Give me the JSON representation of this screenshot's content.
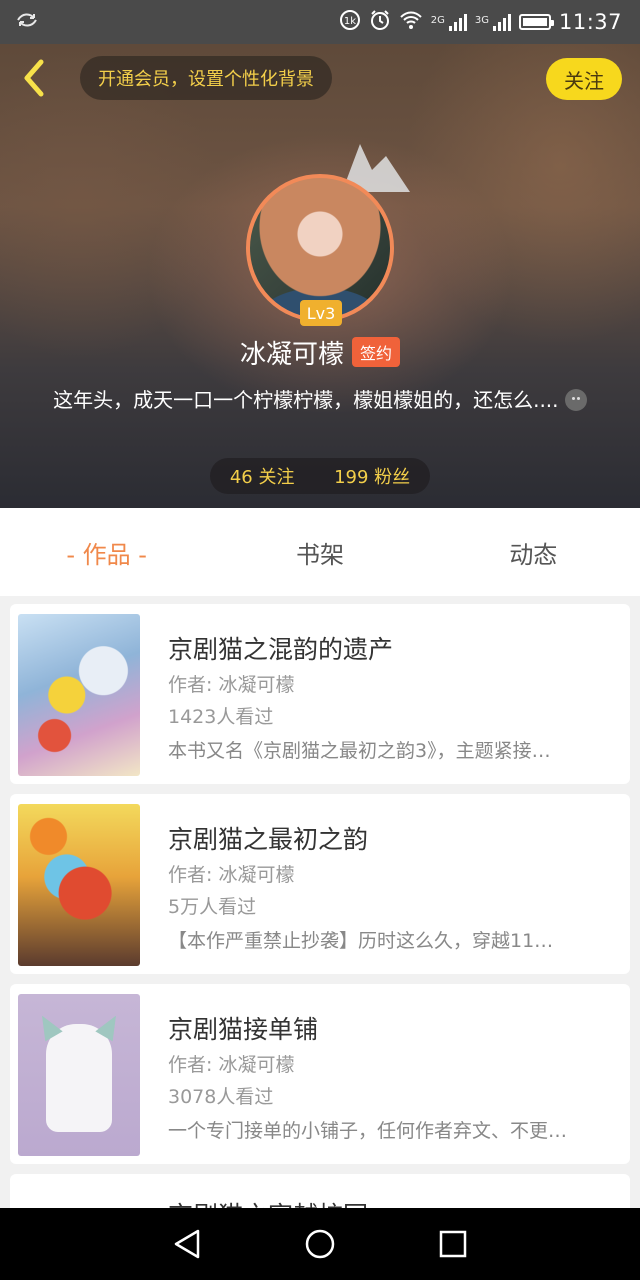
{
  "status_bar": {
    "network_tag_1": "2G",
    "network_tag_2": "3G",
    "time": "11:37",
    "icons": [
      "app-notification-icon",
      "data-speed-icon",
      "alarm-icon",
      "wifi-icon",
      "signal-icon",
      "battery-icon"
    ]
  },
  "header": {
    "vip_prompt": "开通会员，设置个性化背景",
    "follow_label": "关注",
    "level": "Lv3",
    "username": "冰凝可檬",
    "signed_badge": "签约",
    "bio": "这年头，成天一口一个柠檬柠檬，檬姐檬姐的，还怎么....",
    "following": "46 关注",
    "followers": "199 粉丝"
  },
  "tabs": [
    {
      "label": "- 作品 -",
      "active": true
    },
    {
      "label": "书架",
      "active": false
    },
    {
      "label": "动态",
      "active": false
    }
  ],
  "books": [
    {
      "title": "京剧猫之混韵的遗产",
      "author": "作者: 冰凝可檬",
      "views": "1423人看过",
      "description": "本书又名《京剧猫之最初之韵3》，主题紧接…"
    },
    {
      "title": "京剧猫之最初之韵",
      "author": "作者: 冰凝可檬",
      "views": "5万人看过",
      "description": "【本作严重禁止抄袭】历时这么久，穿越11…"
    },
    {
      "title": "京剧猫接单铺",
      "author": "作者: 冰凝可檬",
      "views": "3078人看过",
      "description": "一个专门接单的小铺子，任何作者弃文、不更…"
    },
    {
      "title": "京剧猫之穿越校园"
    }
  ],
  "colors": {
    "accent_orange": "#f0884a",
    "follow_yellow": "#f7d81d",
    "stat_yellow": "#f3cf4a",
    "signed_red": "#f0623a"
  }
}
